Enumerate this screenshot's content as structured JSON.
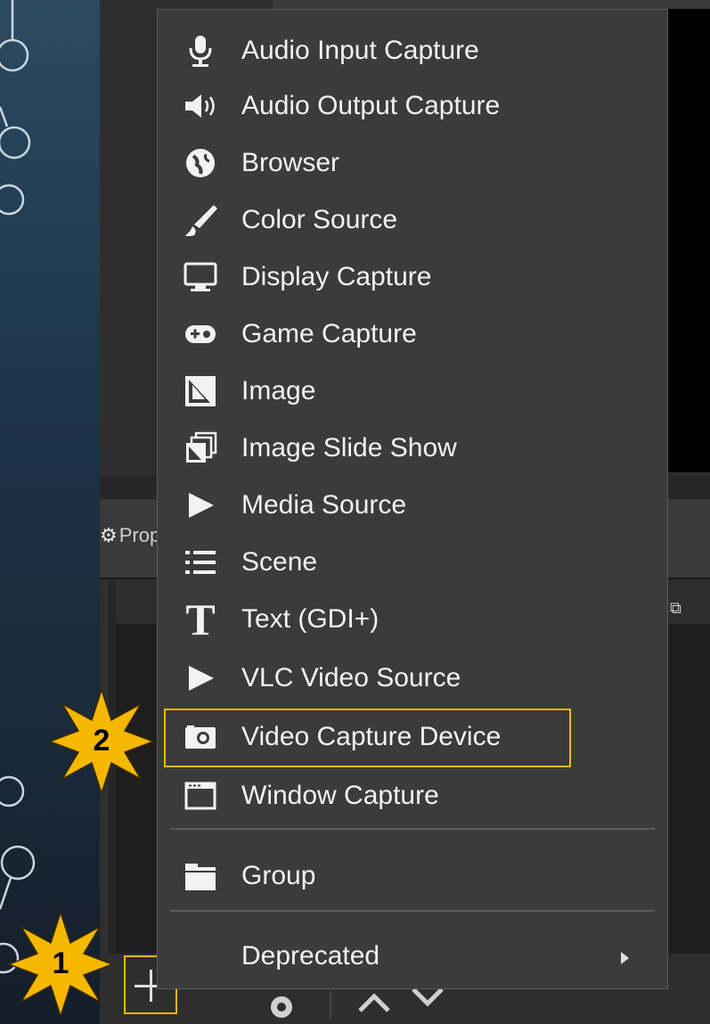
{
  "menu": {
    "items": [
      {
        "label": "Audio Input Capture",
        "icon": "microphone-icon"
      },
      {
        "label": "Audio Output Capture",
        "icon": "speaker-icon"
      },
      {
        "label": "Browser",
        "icon": "globe-icon"
      },
      {
        "label": "Color Source",
        "icon": "paintbrush-icon"
      },
      {
        "label": "Display Capture",
        "icon": "monitor-icon"
      },
      {
        "label": "Game Capture",
        "icon": "gamepad-icon"
      },
      {
        "label": "Image",
        "icon": "image-icon"
      },
      {
        "label": "Image Slide Show",
        "icon": "slideshow-icon"
      },
      {
        "label": "Media Source",
        "icon": "play-icon"
      },
      {
        "label": "Scene",
        "icon": "list-icon"
      },
      {
        "label": "Text (GDI+)",
        "icon": "text-icon"
      },
      {
        "label": "VLC Video Source",
        "icon": "play-icon"
      },
      {
        "label": "Video Capture Device",
        "icon": "camera-icon"
      },
      {
        "label": "Window Capture",
        "icon": "window-icon"
      },
      {
        "label": "Group",
        "icon": "folder-icon"
      },
      {
        "label": "Deprecated",
        "icon": "none"
      }
    ],
    "highlighted_item": "Video Capture Device"
  },
  "dock": {
    "properties_label": "Prop"
  },
  "callouts": {
    "step1": "1",
    "step2": "2"
  },
  "colors": {
    "accent": "#f5b800",
    "menu_bg": "#3b3b3b",
    "menu_text": "#f2f2f2"
  }
}
